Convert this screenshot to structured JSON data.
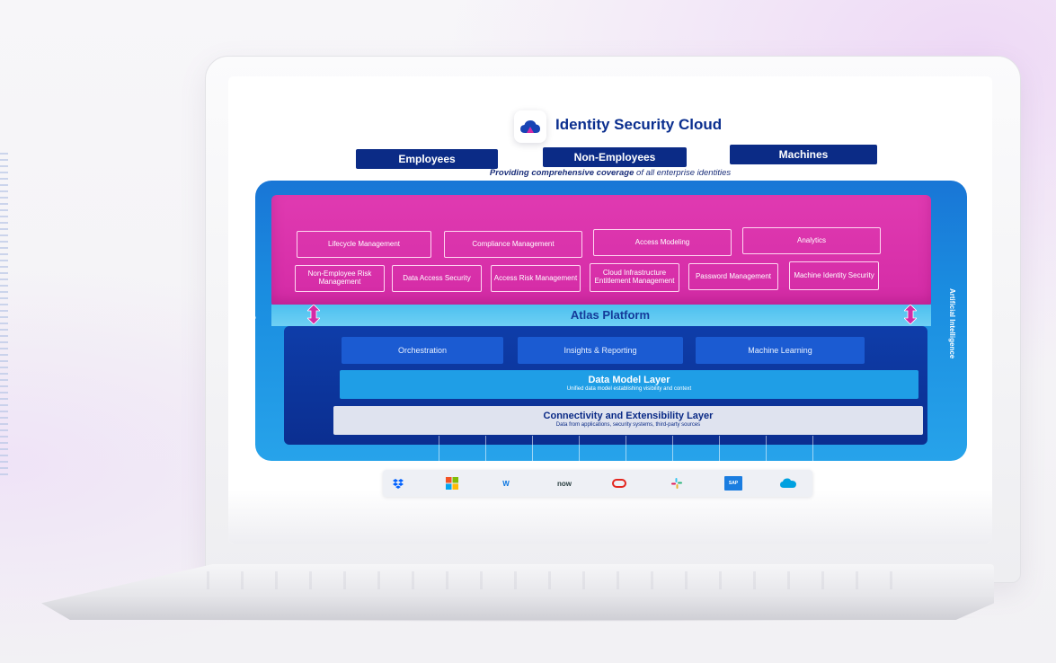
{
  "header": {
    "title": "Identity Security Cloud",
    "identities": [
      "Employees",
      "Non-Employees",
      "Machines"
    ],
    "tagline_bold": "Providing comprehensive coverage",
    "tagline_rest": " of all enterprise identities"
  },
  "platform": {
    "ai_label": "Artificial Intelligence",
    "services_row1": [
      "Lifecycle Management",
      "Compliance Management",
      "Access Modeling",
      "Analytics"
    ],
    "services_row2": [
      "Non-Employee Risk Management",
      "Data Access Security",
      "Access Risk Management",
      "Cloud Infrastructure Entitlement Management",
      "Password Management",
      "Machine Identity Security"
    ],
    "atlas": "Atlas Platform",
    "capabilities": [
      "Orchestration",
      "Insights & Reporting",
      "Machine Learning"
    ],
    "data_model": {
      "title": "Data Model Layer",
      "subtitle": "Unified data model establishing visibility and context"
    },
    "connectivity": {
      "title": "Connectivity and Extensibility Layer",
      "subtitle": "Data from applications, security systems, third-party sources"
    }
  },
  "apps": [
    {
      "icon": "dropbox-icon",
      "label": ""
    },
    {
      "icon": "microsoft-icon",
      "label": ""
    },
    {
      "icon": "workday-icon",
      "label": "W"
    },
    {
      "icon": "servicenow-icon",
      "label": "now"
    },
    {
      "icon": "oracle-icon",
      "label": ""
    },
    {
      "icon": "slack-icon",
      "label": ""
    },
    {
      "icon": "sap-icon",
      "label": "SAP"
    },
    {
      "icon": "salesforce-icon",
      "label": ""
    }
  ],
  "colors": {
    "navy": "#0b2b86",
    "magenta": "#d42ba6",
    "sky": "#1a8de0",
    "deep_blue": "#0e3da9"
  }
}
